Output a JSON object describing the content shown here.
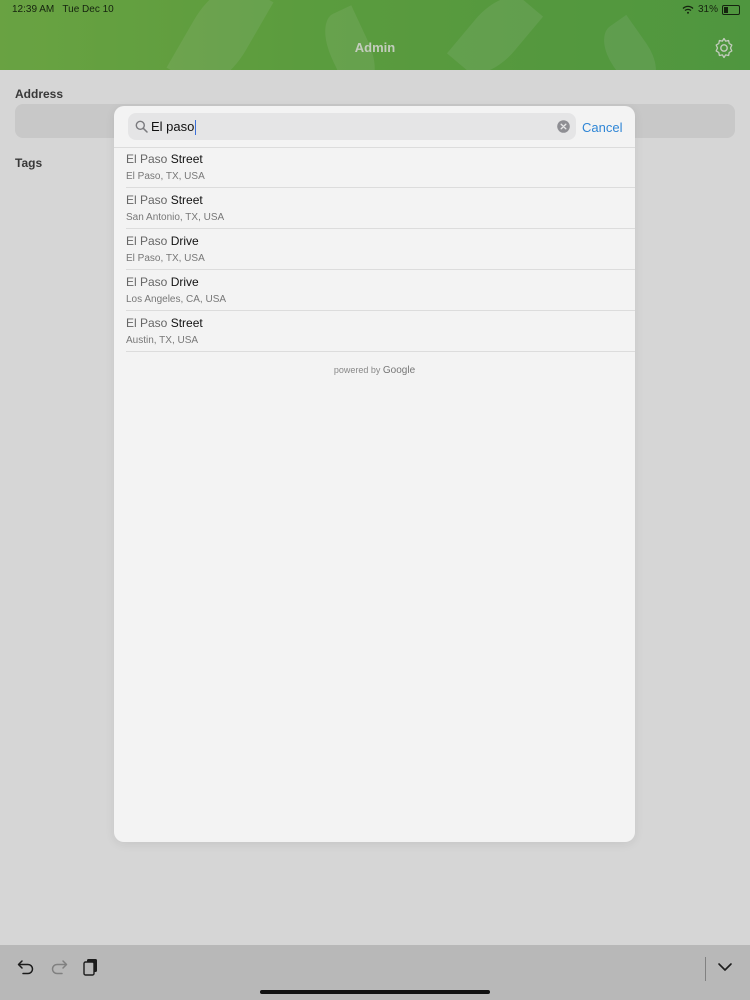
{
  "status_bar": {
    "time": "12:39 AM",
    "date": "Tue Dec 10",
    "battery": "31%"
  },
  "header": {
    "title": "Admin"
  },
  "form": {
    "address_label": "Address",
    "tags_label": "Tags"
  },
  "search": {
    "query": "El paso",
    "cancel_label": "Cancel"
  },
  "results": [
    {
      "match": "El Paso",
      "rest": "Street",
      "subtitle": "El Paso, TX, USA"
    },
    {
      "match": "El Paso",
      "rest": "Street",
      "subtitle": "San Antonio, TX, USA"
    },
    {
      "match": "El Paso",
      "rest": "Drive",
      "subtitle": "El Paso, TX, USA"
    },
    {
      "match": "El Paso",
      "rest": "Drive",
      "subtitle": "Los Angeles, CA, USA"
    },
    {
      "match": "El Paso",
      "rest": "Street",
      "subtitle": "Austin, TX, USA"
    }
  ],
  "attribution": {
    "prefix": "powered by",
    "brand": "Google"
  },
  "colors": {
    "header_green": "#6dba4a",
    "link_blue": "#2f86d6",
    "modal_bg": "#f3f3f3"
  },
  "icons": [
    "search-icon",
    "clear-icon",
    "gear-icon",
    "undo-icon",
    "redo-icon",
    "paste-icon",
    "chevron-down-icon",
    "wifi-icon",
    "battery-icon"
  ]
}
